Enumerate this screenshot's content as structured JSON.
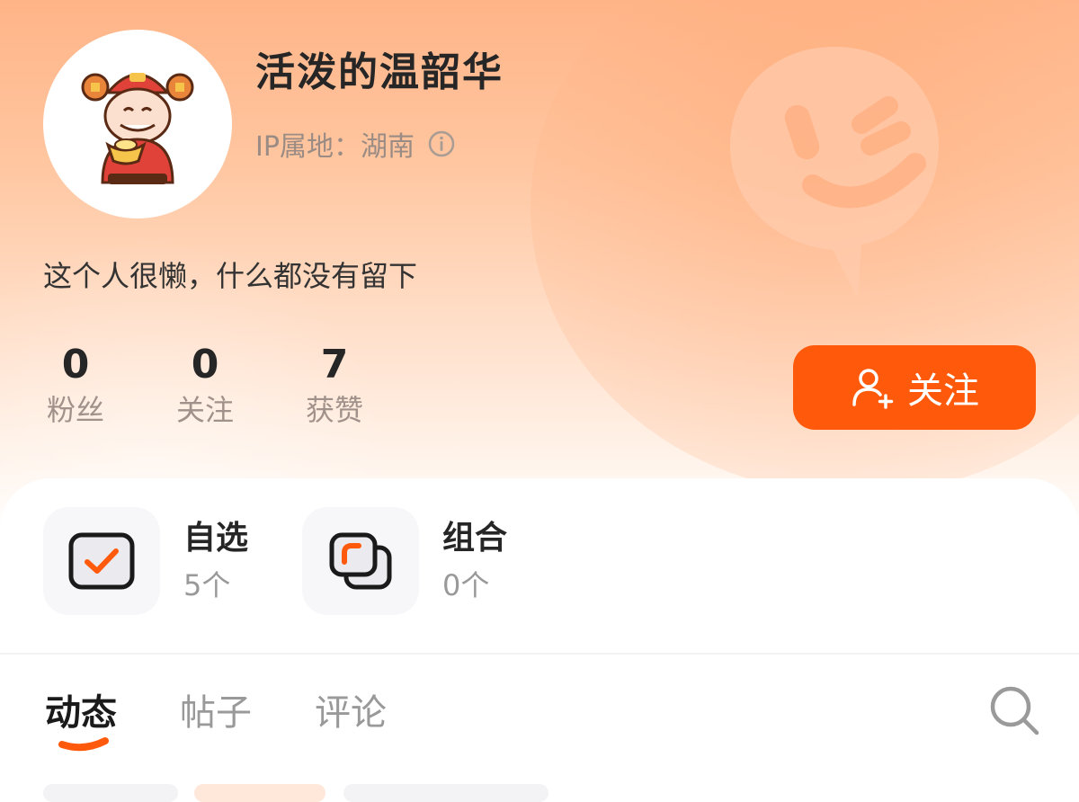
{
  "profile": {
    "username": "活泼的温韶华",
    "ip_location": "IP属地：湖南",
    "bio": "这个人很懒，什么都没有留下"
  },
  "stats": [
    {
      "value": "0",
      "label": "粉丝"
    },
    {
      "value": "0",
      "label": "关注"
    },
    {
      "value": "7",
      "label": "获赞"
    }
  ],
  "follow_button": {
    "label": "关注"
  },
  "shortcuts": [
    {
      "title": "自选",
      "count": "5个",
      "icon": "checkbox-icon"
    },
    {
      "title": "组合",
      "count": "0个",
      "icon": "stack-icon"
    }
  ],
  "tabs": [
    {
      "label": "动态",
      "active": true
    },
    {
      "label": "帖子",
      "active": false
    },
    {
      "label": "评论",
      "active": false
    }
  ],
  "colors": {
    "accent": "#ff5a0c",
    "header_top": "#ffb487",
    "text_primary": "#262626",
    "text_secondary": "#999999"
  }
}
